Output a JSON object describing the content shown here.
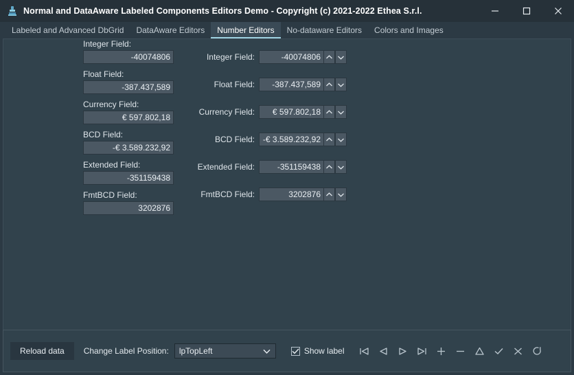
{
  "window": {
    "title": "Normal and DataAware Labeled Components Editors Demo - Copyright (c) 2021-2022 Ethea S.r.l.",
    "icon": "app-icon",
    "controls": {
      "minimize": "minimize-icon",
      "maximize": "maximize-icon",
      "close": "close-icon"
    }
  },
  "tabs": [
    {
      "label": "Labeled and Advanced DbGrid",
      "active": false
    },
    {
      "label": "DataAware Editors",
      "active": false
    },
    {
      "label": "Number Editors",
      "active": true
    },
    {
      "label": "No-dataware Editors",
      "active": false
    },
    {
      "label": "Colors and Images",
      "active": false
    }
  ],
  "left_column": [
    {
      "label": "Integer Field:",
      "value": "-40074806"
    },
    {
      "label": "Float Field:",
      "value": "-387.437,589"
    },
    {
      "label": "Currency Field:",
      "value": "€ 597.802,18"
    },
    {
      "label": "BCD Field:",
      "value": "-€ 3.589.232,92"
    },
    {
      "label": "Extended Field:",
      "value": "-351159438"
    },
    {
      "label": "FmtBCD Field:",
      "value": "3202876"
    }
  ],
  "right_column": [
    {
      "label": "Integer Field:",
      "value": "-40074806"
    },
    {
      "label": "Float Field:",
      "value": "-387.437,589"
    },
    {
      "label": "Currency Field:",
      "value": "€ 597.802,18"
    },
    {
      "label": "BCD Field:",
      "value": "-€ 3.589.232,92"
    },
    {
      "label": "Extended Field:",
      "value": "-351159438"
    },
    {
      "label": "FmtBCD Field:",
      "value": "3202876"
    }
  ],
  "bottom": {
    "reload_label": "Reload data",
    "position_label": "Change Label Position:",
    "position_value": "lpTopLeft",
    "position_options": [
      "lpTopLeft"
    ],
    "show_label_text": "Show label",
    "show_label_checked": true,
    "nav_buttons": [
      {
        "name": "first-record-icon",
        "title": "First"
      },
      {
        "name": "prior-record-icon",
        "title": "Prior"
      },
      {
        "name": "next-record-icon",
        "title": "Next"
      },
      {
        "name": "last-record-icon",
        "title": "Last"
      },
      {
        "name": "insert-record-icon",
        "title": "Insert"
      },
      {
        "name": "delete-record-icon",
        "title": "Delete"
      },
      {
        "name": "edit-record-icon",
        "title": "Edit"
      },
      {
        "name": "post-record-icon",
        "title": "Post"
      },
      {
        "name": "cancel-record-icon",
        "title": "Cancel"
      },
      {
        "name": "refresh-record-icon",
        "title": "Refresh"
      }
    ]
  },
  "colors": {
    "window_bg": "#2c3a44",
    "titlebar_bg": "#263139",
    "panel_bg": "#31424c",
    "field_bg": "#4b5863",
    "accent": "#9fd3e3",
    "text": "#e9eef2"
  }
}
